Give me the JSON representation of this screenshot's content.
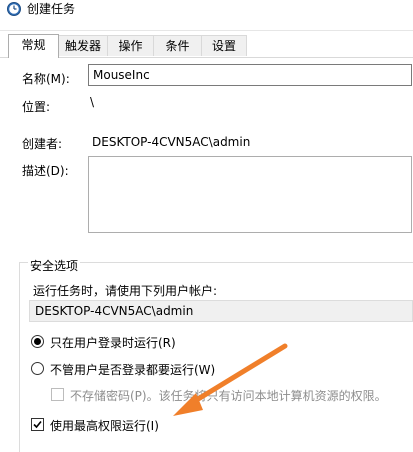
{
  "window": {
    "title": "创建任务"
  },
  "tabs": [
    {
      "label": "常规"
    },
    {
      "label": "触发器"
    },
    {
      "label": "操作"
    },
    {
      "label": "条件"
    },
    {
      "label": "设置"
    }
  ],
  "general": {
    "name_label": "名称(M):",
    "name_value": "MouseInc",
    "location_label": "位置:",
    "location_value": "\\",
    "author_label": "创建者:",
    "author_value": "DESKTOP-4CVN5AC\\admin",
    "description_label": "描述(D):",
    "description_value": ""
  },
  "security": {
    "legend": "安全选项",
    "run_as_prompt": "运行任务时，请使用下列用户帐户:",
    "user_account": "DESKTOP-4CVN5AC\\admin",
    "radio_logged_on": "只在用户登录时运行(R)",
    "radio_whether_logged_on": "不管用户是否登录都要运行(W)",
    "no_store_password": "不存储密码(P)。该任务将只有访问本地计算机资源的权限。",
    "highest_privileges": "使用最高权限运行(I)"
  },
  "colors": {
    "annotation_arrow": "#f07f2a"
  }
}
